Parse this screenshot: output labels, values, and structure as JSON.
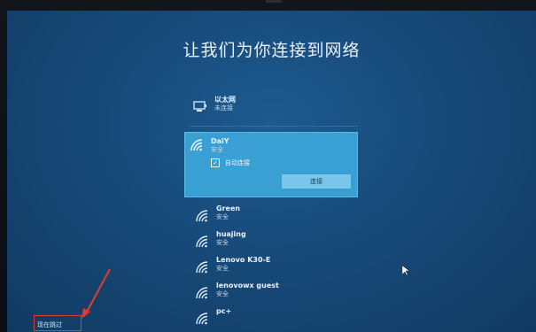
{
  "title": "让我们为你连接到网络",
  "ethernet": {
    "name": "以太网",
    "status": "未连接",
    "icon": "ethernet-icon"
  },
  "selected_network": {
    "name": "DaiY",
    "security": "安全",
    "auto_connect_label": "自动连接",
    "auto_connect_checked": true,
    "connect_label": "连接",
    "icon": "wifi-icon"
  },
  "networks": [
    {
      "name": "Green",
      "security": "安全"
    },
    {
      "name": "huajing",
      "security": "安全"
    },
    {
      "name": "Lenovo K30-E",
      "security": "安全"
    },
    {
      "name": "lenovowx guest",
      "security": "安全"
    },
    {
      "name": "pc+",
      "security": ""
    }
  ],
  "skip_label": "现在跳过",
  "colors": {
    "screen": "#174a79",
    "selected_bg": "#3aa0d4",
    "button_bg": "#7ac6ea",
    "annotation_red": "#e23b2e"
  }
}
